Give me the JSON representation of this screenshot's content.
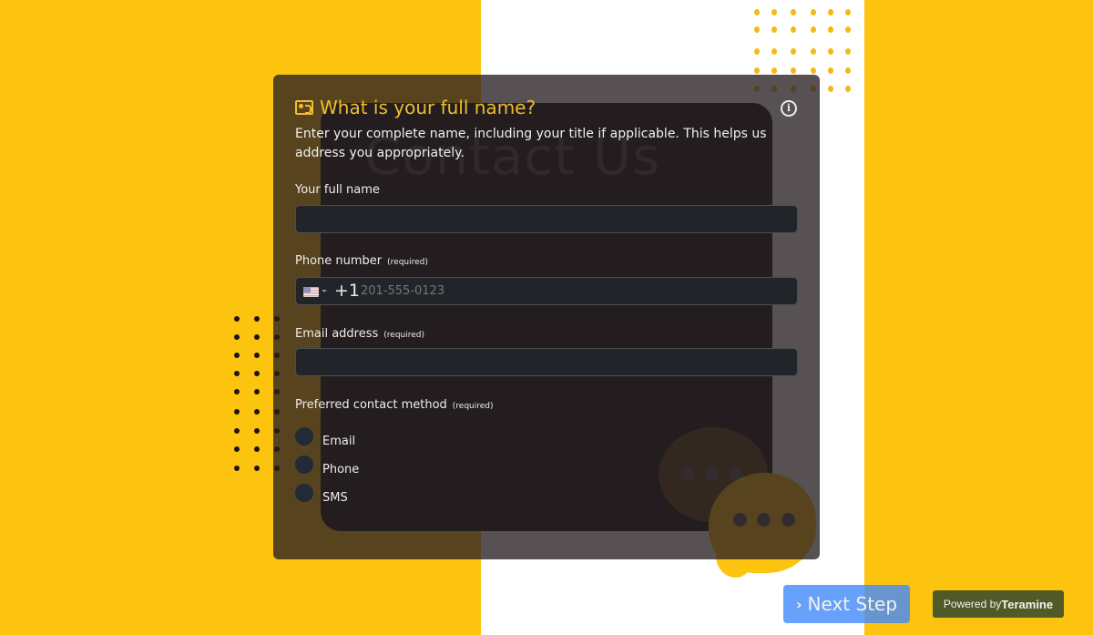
{
  "background": {
    "accent": "#fcc40f",
    "panel_text": "Contact Us"
  },
  "form": {
    "title": "What is your full name?",
    "title_icon": "id-card-icon",
    "info_icon": "info-icon",
    "description": "Enter your complete name, including your title if applicable. This helps us address you appropriately.",
    "fields": {
      "full_name": {
        "label": "Your full name",
        "value": "",
        "placeholder": ""
      },
      "phone": {
        "label": "Phone number",
        "required": "(required)",
        "country_flag": "us-flag-icon",
        "country_code": "+1",
        "placeholder": "201-555-0123",
        "value": ""
      },
      "email": {
        "label": "Email address",
        "required": "(required)",
        "value": "",
        "placeholder": ""
      },
      "contact_method": {
        "label": "Preferred contact method",
        "required": "(required)",
        "options": [
          "Email",
          "Phone",
          "SMS"
        ],
        "selected": null
      }
    }
  },
  "footer": {
    "next_label": "Next Step",
    "next_icon": "chevron-right-icon",
    "powered_prefix": "Powered by",
    "powered_brand": "Teramine"
  }
}
